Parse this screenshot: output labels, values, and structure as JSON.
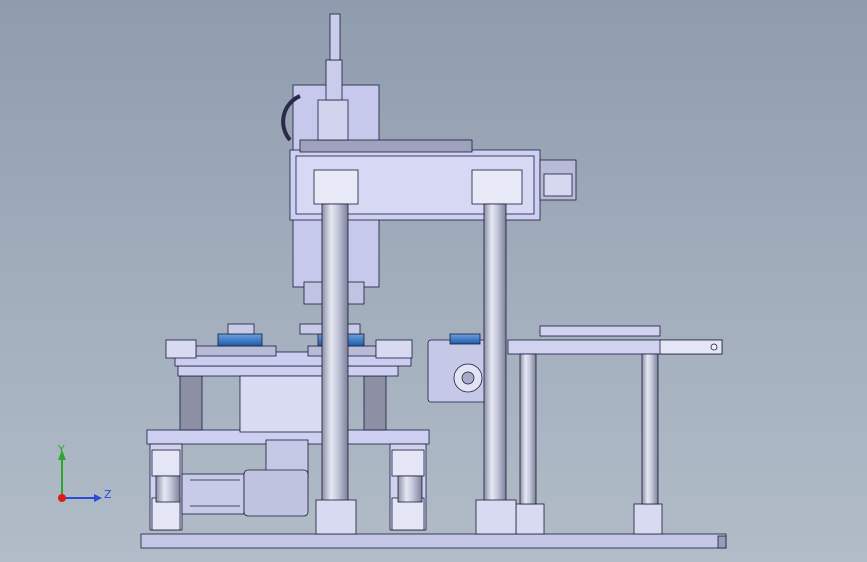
{
  "viewport": {
    "background_top": "#8f9cae",
    "background_bottom": "#b1bcc8"
  },
  "model": {
    "part_fill": "#c9ccf0",
    "part_stroke": "#1b1b3a",
    "column_color": "#c5c9dc",
    "accent_blue": "#2f6fc0"
  },
  "triad": {
    "y_label": "Y",
    "z_label": "Z",
    "y_color": "#2fa52f",
    "z_color": "#2a4cd6",
    "origin_color": "#e01818"
  }
}
